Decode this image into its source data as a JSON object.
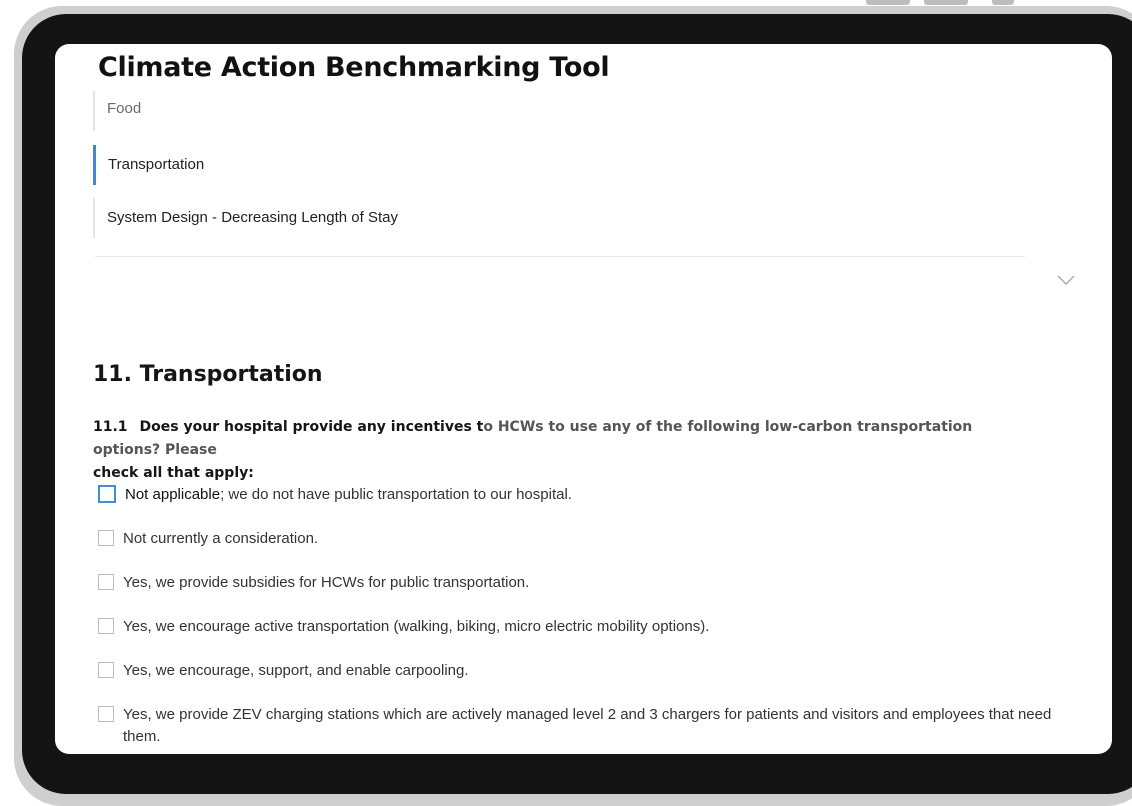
{
  "app": {
    "title": "Climate Action Benchmarking Tool"
  },
  "nav": {
    "items": [
      {
        "label": "Food",
        "active": false
      },
      {
        "label": "Transportation",
        "active": true
      },
      {
        "label": "System Design - Decreasing Length of Stay",
        "active": false
      }
    ],
    "expand_icon": "chevron-down-icon"
  },
  "section": {
    "title": "11. Transportation",
    "question": {
      "number": "11.1",
      "text_dark": "Does your hospital provide any incentives t",
      "text_muted": "o HCWs to use any of the following low-carbon transportation options? Please",
      "text_line2": "check all that apply:"
    },
    "options": [
      {
        "label_strong": "Not applicable",
        "label": "; we do not have public transportation to our hospital.",
        "checked": false,
        "focused": true
      },
      {
        "label_strong": "",
        "label": "Not currently a consideration.",
        "checked": false,
        "focused": false
      },
      {
        "label_strong": "",
        "label": "Yes, we provide subsidies for HCWs for public transportation.",
        "checked": false,
        "focused": false
      },
      {
        "label_strong": "",
        "label": "Yes, we encourage active transportation (walking, biking, micro electric mobility options).",
        "checked": false,
        "focused": false
      },
      {
        "label_strong": "",
        "label": "Yes, we encourage, support, and enable carpooling.",
        "checked": false,
        "focused": false
      },
      {
        "label_strong": "",
        "label": "Yes, we provide ZEV charging stations which are actively managed level 2 and 3 chargers for patients and visitors and employees that need them.",
        "checked": false,
        "focused": false
      }
    ]
  },
  "colors": {
    "accent": "#2d8ce6",
    "focus": "#3b8fd6",
    "device_frame": "#141414"
  }
}
